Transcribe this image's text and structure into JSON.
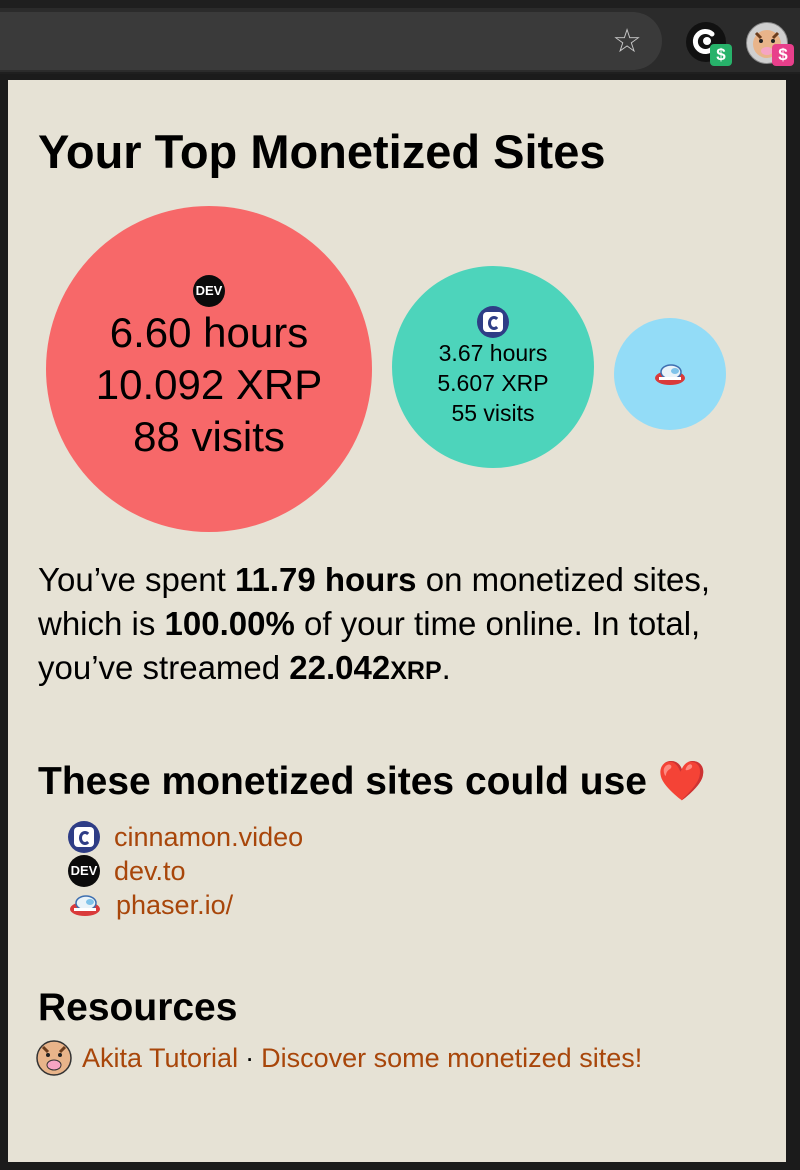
{
  "toolbar": {
    "bookmark_icon": "star-icon",
    "extensions": [
      {
        "icon": "coil-extension-icon",
        "badge": "$",
        "badge_color": "#27b26a"
      },
      {
        "icon": "akita-extension-icon",
        "badge": "$",
        "badge_color": "#e83f8b"
      }
    ],
    "star_glyph": "☆"
  },
  "popup": {
    "title": "Your Top Monetized Sites",
    "bubbles": [
      {
        "site_icon": "dev-icon",
        "icon_text": "DEV",
        "hours": "6.60 hours",
        "xrp": "10.092 XRP",
        "visits": "88 visits",
        "color": "#f76869"
      },
      {
        "site_icon": "cinnamon-icon",
        "hours": "3.67 hours",
        "xrp": "5.607 XRP",
        "visits": "55 visits",
        "color": "#4dd4bb"
      },
      {
        "site_icon": "phaser-icon",
        "color": "#93dcf7"
      }
    ],
    "summary": {
      "t1": "You’ve spent ",
      "hours": "11.79 hours",
      "t2": " on monetized sites, which is ",
      "percent": "100.00%",
      "t3": " of your time online. In total, you’ve streamed ",
      "amount": "22.042",
      "unit": "XRP",
      "t4": "."
    },
    "could_use": {
      "title_text": "These monetized sites could use",
      "heart": "❤️",
      "sites": [
        {
          "icon": "cinnamon-icon",
          "label": "cinnamon.video"
        },
        {
          "icon": "dev-icon",
          "icon_text": "DEV",
          "label": "dev.to"
        },
        {
          "icon": "phaser-icon",
          "label": "phaser.io/"
        }
      ]
    },
    "resources": {
      "title": "Resources",
      "icon": "akita-icon",
      "link1": "Akita Tutorial",
      "separator": "·",
      "link2": "Discover some monetized sites!"
    }
  },
  "colors": {
    "panel_bg": "#e6e2d5",
    "link": "#a8460a",
    "toolbar_bg": "#2b2b2b"
  }
}
